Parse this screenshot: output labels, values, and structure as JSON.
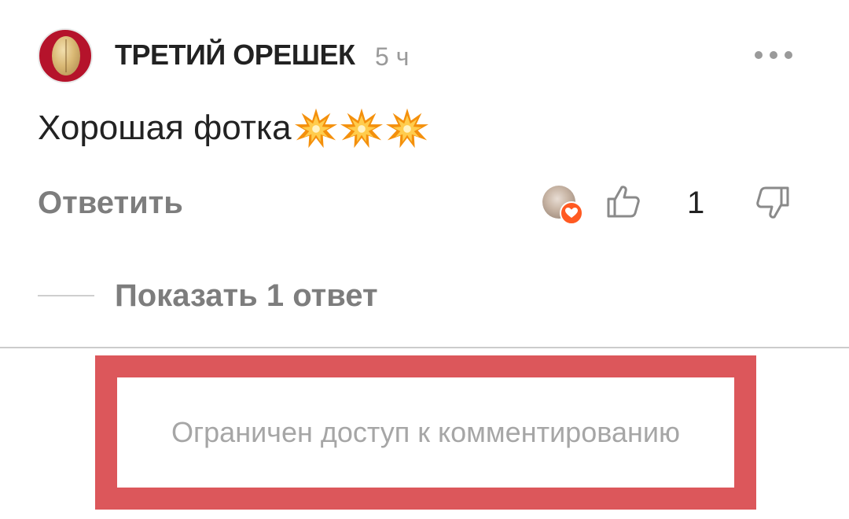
{
  "comment": {
    "author": "ТРЕТИЙ ОРЕШЕК",
    "time_ago": "5 ч",
    "text": "Хорошая фотка",
    "emoji_icons": [
      "collision-emoji-icon",
      "collision-emoji-icon",
      "collision-emoji-icon"
    ],
    "reply_label": "Ответить",
    "like_count": "1",
    "show_replies_label": "Показать 1 ответ"
  },
  "notice": {
    "restricted_text": "Ограничен доступ к комментированию"
  },
  "colors": {
    "avatar_bg": "#b5132b",
    "heart_badge": "#ff5a22",
    "notice_frame": "#dc575b",
    "muted_text": "#7d7d7d"
  }
}
